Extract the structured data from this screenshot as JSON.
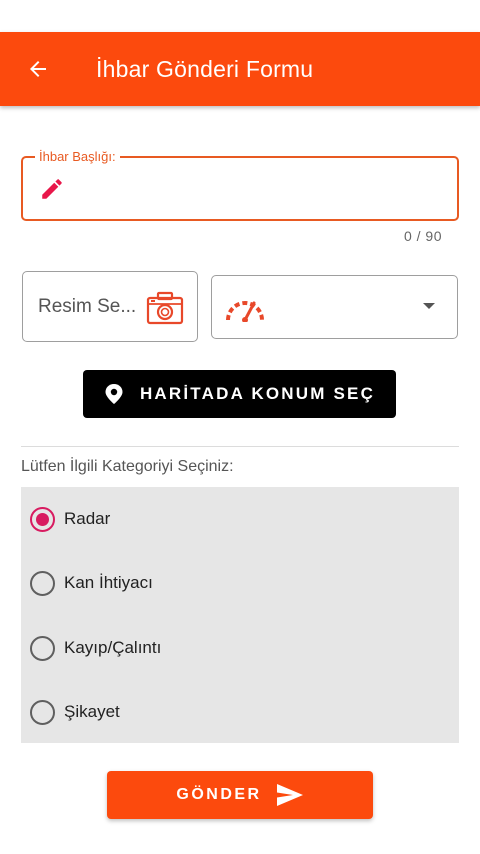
{
  "app_bar": {
    "title": "İhbar Gönderi Formu",
    "back_icon": "arrow-left-icon",
    "color": "#fc4a0d"
  },
  "title_field": {
    "label": "İhbar Başlığı:",
    "value": "",
    "icon": "pencil-icon",
    "counter": "0 / 90",
    "accent": "#e85a22"
  },
  "image_picker": {
    "label": "Resim Se...",
    "icon": "camera-icon"
  },
  "speed_dropdown": {
    "icon": "speedometer-icon",
    "selected": ""
  },
  "map_button": {
    "label": "HARİTADA KONUM SEÇ",
    "icon": "location-pin-icon"
  },
  "categories": {
    "prompt": "Lütfen İlgili Kategoriyi Seçiniz:",
    "selected_index": 0,
    "options": [
      {
        "label": "Radar"
      },
      {
        "label": "Kan İhtiyacı"
      },
      {
        "label": "Kayıp/Çalıntı"
      },
      {
        "label": "Şikayet"
      }
    ],
    "radio_color": "#d81b60"
  },
  "submit_button": {
    "label": "GÖNDER",
    "icon": "send-icon"
  }
}
